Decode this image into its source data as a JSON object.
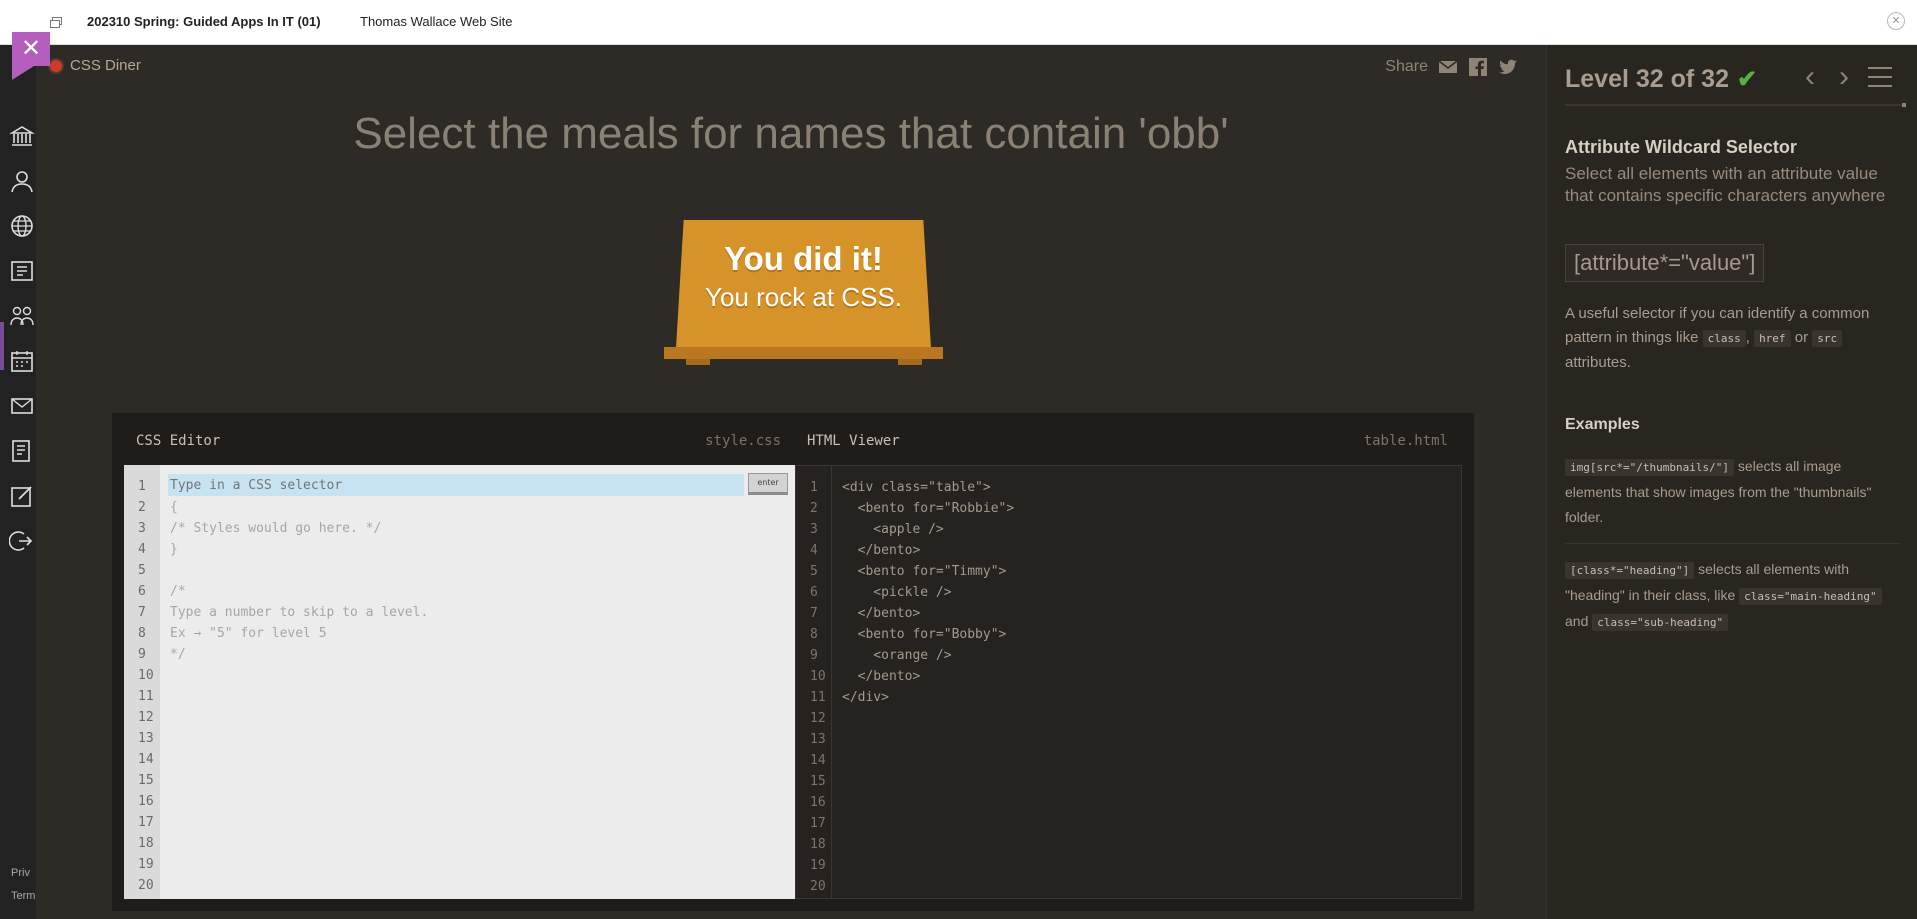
{
  "topbar": {
    "course": "202310 Spring: Guided Apps In IT (01)",
    "site": "Thomas Wallace Web Site"
  },
  "rail": {
    "footer_1": "Priv",
    "footer_2": "Term",
    "icons": [
      "institution-icon",
      "account-icon",
      "globe-icon",
      "courses-icon",
      "groups-icon",
      "calendar-icon",
      "inbox-icon",
      "history-icon",
      "commons-icon",
      "logout-icon"
    ]
  },
  "app": {
    "logo": "CSS Diner",
    "share_label": "Share",
    "instruction": "Select the meals for names that contain 'obb'",
    "winner_line1": "You did it!",
    "winner_line2": "You rock at CSS."
  },
  "css_editor": {
    "title": "CSS Editor",
    "file": "style.css",
    "placeholder": "Type in a CSS selector",
    "enter_label": "enter",
    "line_numbers": [
      "1",
      "2",
      "3",
      "4",
      "5",
      "6",
      "7",
      "8",
      "9",
      "10",
      "11",
      "12",
      "13",
      "14",
      "15",
      "16",
      "17",
      "18",
      "19",
      "20"
    ],
    "lines": [
      "",
      "{",
      "/* Styles would go here. */",
      "}",
      "",
      "/*",
      "Type a number to skip to a level.",
      "Ex → \"5\" for level 5",
      "*/"
    ]
  },
  "html_viewer": {
    "title": "HTML Viewer",
    "file": "table.html",
    "line_numbers": [
      "1",
      "2",
      "3",
      "4",
      "5",
      "6",
      "7",
      "8",
      "9",
      "10",
      "11",
      "12",
      "13",
      "14",
      "15",
      "16",
      "17",
      "18",
      "19",
      "20"
    ],
    "lines": [
      "<div class=\"table\">",
      "  <bento for=\"Robbie\">",
      "    <apple />",
      "  </bento>",
      "  <bento for=\"Timmy\">",
      "    <pickle />",
      "  </bento>",
      "  <bento for=\"Bobby\">",
      "    <orange />",
      "  </bento>",
      "</div>"
    ]
  },
  "sidebar": {
    "level": "Level 32 of 32",
    "selector_name": "Attribute Wildcard Selector",
    "description": "Select all elements with an attribute value that contains specific characters anywhere",
    "syntax": "[attribute*=\"value\"]",
    "help_pre": "A useful selector if you can identify a common pattern in things like",
    "help_code1": "class",
    "help_sep1": ",",
    "help_code2": "href",
    "help_sep2": "or",
    "help_code3": "src",
    "help_post": "attributes.",
    "examples_title": "Examples",
    "ex1_code": "img[src*=\"/thumbnails/\"]",
    "ex1_text": "selects all image elements that show images from the \"thumbnails\" folder.",
    "ex2_code": "[class*=\"heading\"]",
    "ex2_text1": "selects all elements with \"heading\" in their class, like",
    "ex2_code2": "class=\"main-heading\"",
    "ex2_and": "and",
    "ex2_code3": "class=\"sub-heading\""
  },
  "colors": {
    "accent_orange": "#d6932a",
    "check_green": "#57b042",
    "close_purple": "#b45fbd"
  }
}
